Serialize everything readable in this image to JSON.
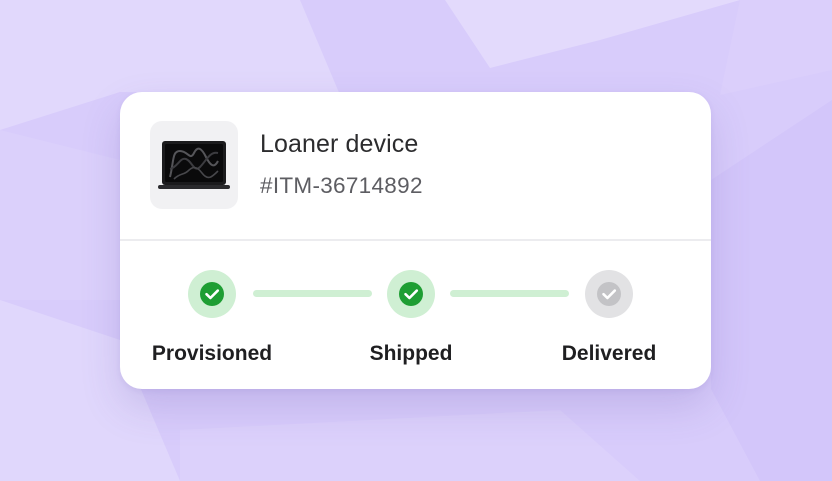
{
  "colors": {
    "background": "#d8ccfb",
    "card": "#ffffff",
    "done_ring": "#cfefd3",
    "done_fill": "#1e9e33",
    "pending_ring": "#e2e2e4",
    "pending_fill": "#c3c3c6",
    "connector": "#cfefd3"
  },
  "item": {
    "thumbnail_icon": "laptop-icon",
    "title": "Loaner device",
    "id": "#ITM-36714892"
  },
  "tracker": {
    "steps": [
      {
        "label": "Provisioned",
        "status": "done",
        "icon": "check-icon"
      },
      {
        "label": "Shipped",
        "status": "done",
        "icon": "check-icon"
      },
      {
        "label": "Delivered",
        "status": "pending",
        "icon": "check-icon"
      }
    ]
  }
}
